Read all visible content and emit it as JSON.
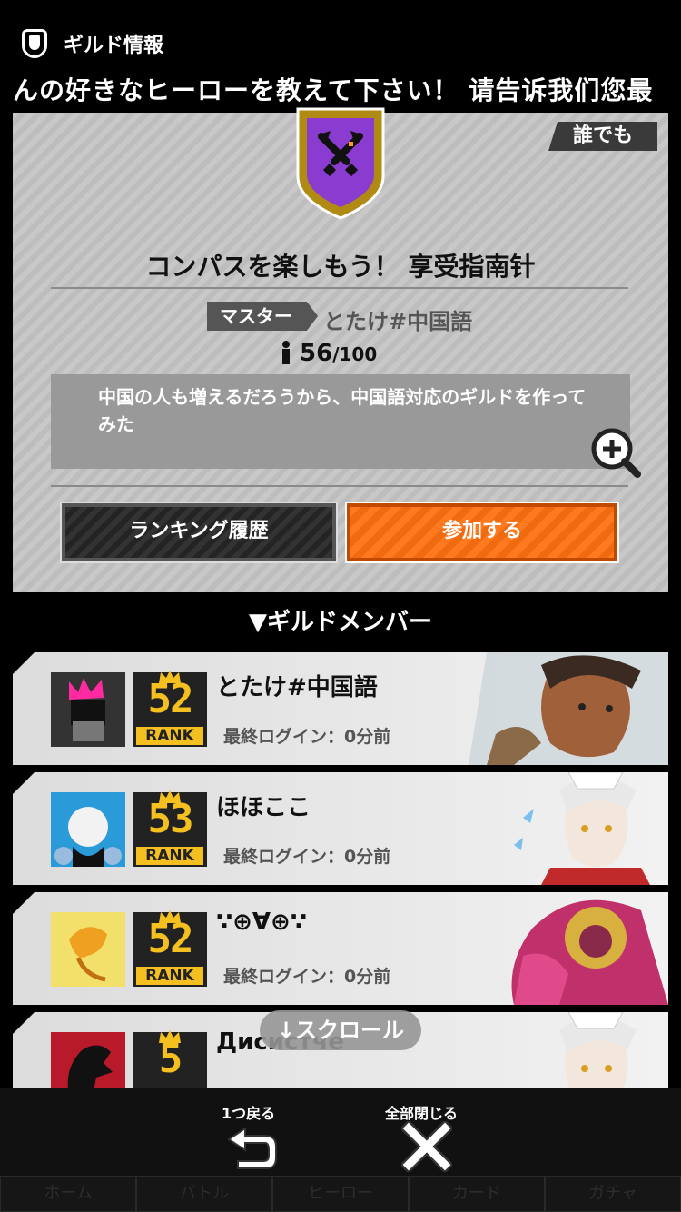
{
  "header": {
    "title": "ギルド情報"
  },
  "ticker": {
    "text": "んの好きなヒーローを教えて下さい！ 请告诉我们您最"
  },
  "guild": {
    "visibility_badge": "誰でも",
    "name": "コンパスを楽しもう！ 享受指南针",
    "master_label": "マスター",
    "master_name": "とたけ#中国語",
    "member_count": "56",
    "member_max": "/100",
    "description": "中国の人も増えるだろうから、中国語対応のギルドを作ってみた",
    "ranking_button": "ランキング履歴",
    "join_button": "参加する"
  },
  "members_title": "▼ギルドメンバー",
  "members": [
    {
      "name": "とたけ#中国語",
      "rank": "52",
      "rank_label": "RANK",
      "last_login": "最終ログイン：0分前"
    },
    {
      "name": "ほほここ",
      "rank": "53",
      "rank_label": "RANK",
      "last_login": "最終ログイン：0分前"
    },
    {
      "name": "∵⊕∀⊕∵",
      "rank": "52",
      "rank_label": "RANK",
      "last_login": "最終ログイン：0分前"
    },
    {
      "name": "Дисистче",
      "rank": "5",
      "rank_label": "",
      "last_login": ""
    }
  ],
  "scroll_hint": "↓スクロール",
  "bottom": {
    "back_label": "1つ戻る",
    "close_all_label": "全部閉じる",
    "nav": [
      "ホーム",
      "バトル",
      "ヒーロー",
      "カード",
      "ガチャ"
    ]
  },
  "colors": {
    "accent_orange": "#ff7a1f",
    "rank_gold": "#f4c020",
    "emblem_purple": "#8a3cd0"
  }
}
